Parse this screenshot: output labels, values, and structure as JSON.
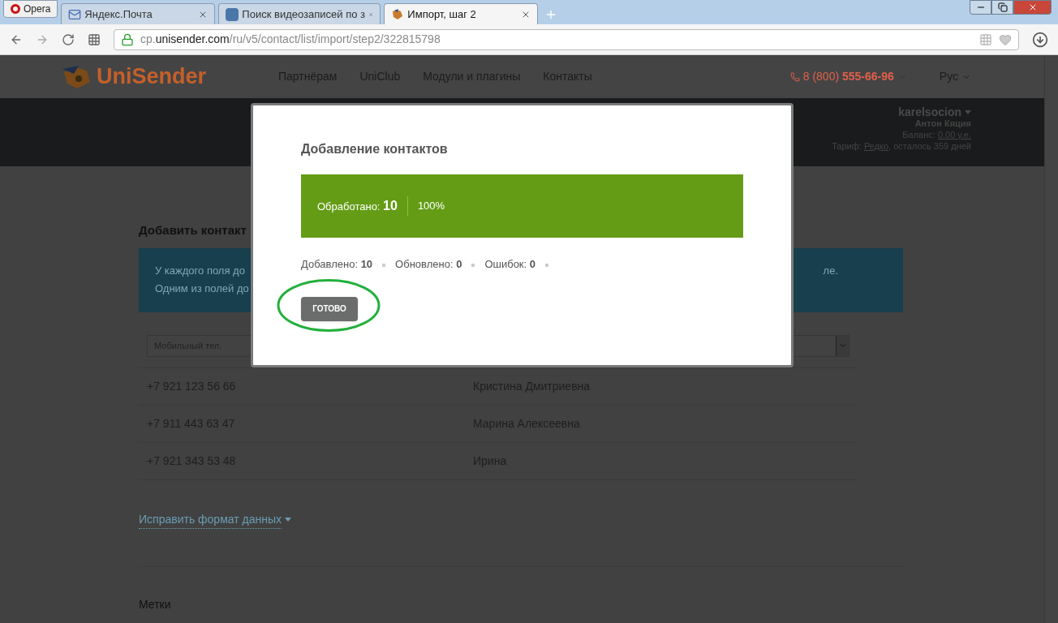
{
  "browser": {
    "menu_button": "Opera",
    "tabs": [
      {
        "title": "Яндекс.Почта",
        "selected": false
      },
      {
        "title": "Поиск видеозаписей по з",
        "selected": false
      },
      {
        "title": "Импорт, шаг 2",
        "selected": true
      }
    ],
    "url": {
      "subdomain": "cp.",
      "domain": "unisender.com",
      "path": "/ru/v5/contact/list/import/step2/322815798"
    }
  },
  "site_header": {
    "logo": "UniSender",
    "nav": [
      "Партнёрам",
      "UniClub",
      "Модули и плагины",
      "Контакты"
    ],
    "phone_prefix": "8 (800)",
    "phone_number": "555-66-96",
    "language": "Рус"
  },
  "account": {
    "username": "karelsocion",
    "name": "Антон Кяция",
    "balance_label": "Баланс:",
    "balance": "0.00 у.е.",
    "tariff_label": "Тариф:",
    "tariff": "Редко",
    "tariff_rest": ", осталось 359 дней"
  },
  "page": {
    "title": "Добавить контакт",
    "notice_lines": [
      "У каждого поля до",
      "Одним из полей до"
    ],
    "notice_tail": "ле.",
    "column_select": "Мобильный тел.",
    "rows": [
      {
        "phone": "+7 921 123 56 66",
        "name": "Кристина Дмитриевна"
      },
      {
        "phone": "+7 911 443 63 47",
        "name": "Марина Алексеевна"
      },
      {
        "phone": "+7 921 343 53 48",
        "name": "Ирина"
      }
    ],
    "fix_link": "Исправить формат данных",
    "tags_label": "Метки"
  },
  "modal": {
    "title": "Добавление контактов",
    "progress": {
      "label": "Обработано:",
      "count": "10",
      "percent": "100%",
      "level": 1
    },
    "stats": [
      {
        "label": "Добавлено:",
        "value": "10"
      },
      {
        "label": "Обновлено:",
        "value": "0"
      },
      {
        "label": "Ошибок:",
        "value": "0"
      }
    ],
    "done_button": "ГОТОВО"
  }
}
